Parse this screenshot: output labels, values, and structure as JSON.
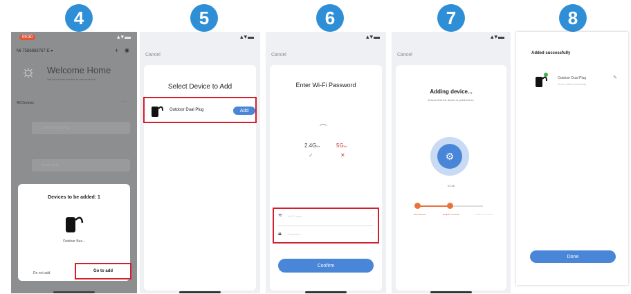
{
  "steps": [
    "4",
    "5",
    "6",
    "7",
    "8"
  ],
  "screen4": {
    "status_time": "09:30",
    "home_selector": "Mi-7586883767-E ▾",
    "welcome": "Welcome Home",
    "welcome_sub": "Set your home location to see more info",
    "all_devices": "All Devices",
    "row1": "Outdoor Dual Plug",
    "row2": "Smart Bulb",
    "modal_title": "Devices to be added: 1",
    "device_label": "Outdoor Bus...",
    "do_not_add": "Do not add",
    "go_to_add": "Go to add"
  },
  "screen5": {
    "cancel": "Cancel",
    "title": "Select Device to Add",
    "device_name": "Outdoor Dual Plug",
    "add_button": "Add"
  },
  "screen6": {
    "cancel": "Cancel",
    "title": "Enter Wi-Fi Password",
    "band_24": "2.4G",
    "band_24_unit": "Hz",
    "band_5": "5G",
    "band_5_unit": "Hz",
    "ssid_placeholder": "Wi-Fi name",
    "password_placeholder": "Password",
    "confirm": "Confirm"
  },
  "screen7": {
    "cancel": "Cancel",
    "title": "Adding device...",
    "subtitle": "Ensure that the device is powered on.",
    "timer": "01:56",
    "step1": "Scan devices.",
    "step2": "Register to Cloud.",
    "step3": "Initialize the device.",
    "progress_steps_done": 2,
    "progress_steps_total": 3
  },
  "screen8": {
    "title": "Added successfully",
    "device_name": "Outdoor Dual Plug",
    "device_sub": "Device added successfully",
    "done": "Done"
  },
  "colors": {
    "accent": "#2f8fd6",
    "highlight": "#d21f2b",
    "button": "#4a86d8",
    "progress": "#e8743b"
  }
}
